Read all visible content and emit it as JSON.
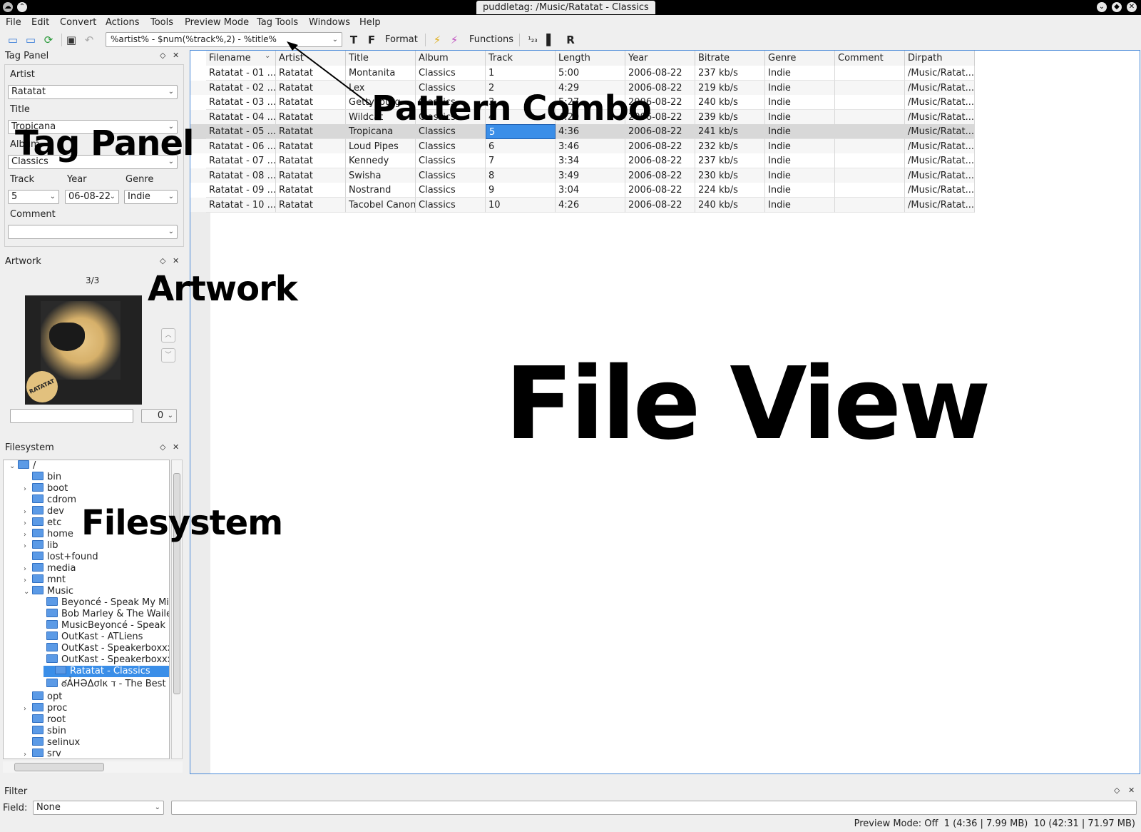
{
  "window": {
    "title": "puddletag: /Music/Ratatat - Classics"
  },
  "menu": [
    "File",
    "Edit",
    "Convert",
    "Actions",
    "Tools",
    "Preview Mode",
    "Tag Tools",
    "Windows",
    "Help"
  ],
  "toolbar": {
    "pattern": "%artist% - $num(%track%,2) - %title%",
    "format_label": "Format",
    "functions_label": "Functions"
  },
  "tag_panel": {
    "title": "Tag Panel",
    "artist_label": "Artist",
    "artist_value": "Ratatat",
    "title_label": "Title",
    "title_value": "Tropicana",
    "album_label": "Album",
    "album_value": "Classics",
    "track_label": "Track",
    "track_value": "5",
    "year_label": "Year",
    "year_value": "06-08-22",
    "genre_label": "Genre",
    "genre_value": "Indie",
    "comment_label": "Comment",
    "comment_value": ""
  },
  "artwork": {
    "title": "Artwork",
    "counter": "3/3",
    "cover_text": "RATATAT",
    "description_value": "",
    "type_value": "0"
  },
  "filesystem": {
    "title": "Filesystem",
    "items": [
      {
        "label": "/",
        "expanded": true
      },
      {
        "label": "bin"
      },
      {
        "label": "boot",
        "expandable": true
      },
      {
        "label": "cdrom"
      },
      {
        "label": "dev",
        "expandable": true
      },
      {
        "label": "etc",
        "expandable": true
      },
      {
        "label": "home",
        "expandable": true
      },
      {
        "label": "lib",
        "expandable": true
      },
      {
        "label": "lost+found"
      },
      {
        "label": "media",
        "expandable": true
      },
      {
        "label": "mnt",
        "expandable": true
      },
      {
        "label": "Music",
        "expanded": true
      },
      {
        "label": "Beyoncé - Speak My Min"
      },
      {
        "label": "Bob Marley & The Wailer"
      },
      {
        "label": "MusicBeyoncé - Speak M"
      },
      {
        "label": "OutKast - ATLiens"
      },
      {
        "label": "OutKast - Speakerboxxx"
      },
      {
        "label": "OutKast - Speakerboxxx"
      },
      {
        "label": "Ratatat - Classics",
        "selected": true
      },
      {
        "label": "ఠẢHƏΔσΙκ ד - The Best c"
      },
      {
        "label": "opt"
      },
      {
        "label": "proc",
        "expandable": true
      },
      {
        "label": "root"
      },
      {
        "label": "sbin"
      },
      {
        "label": "selinux"
      },
      {
        "label": "srv",
        "expandable": true
      }
    ]
  },
  "file_view": {
    "columns": [
      "Filename",
      "Artist",
      "Title",
      "Album",
      "Track",
      "Length",
      "Year",
      "Bitrate",
      "Genre",
      "Comment",
      "Dirpath"
    ],
    "rows": [
      [
        "Ratatat - 01 ...",
        "Ratatat",
        "Montanita",
        "Classics",
        "1",
        "5:00",
        "2006-08-22",
        "237 kb/s",
        "Indie",
        "",
        "/Music/Ratat..."
      ],
      [
        "Ratatat - 02 ...",
        "Ratatat",
        "Lex",
        "Classics",
        "2",
        "4:29",
        "2006-08-22",
        "219 kb/s",
        "Indie",
        "",
        "/Music/Ratat..."
      ],
      [
        "Ratatat - 03 ...",
        "Ratatat",
        "Gettysburg",
        "Classics",
        "3",
        "5:27",
        "2006-08-22",
        "240 kb/s",
        "Indie",
        "",
        "/Music/Ratat..."
      ],
      [
        "Ratatat - 04 ...",
        "Ratatat",
        "Wildcat",
        "Classics",
        "4",
        "4:20",
        "2006-08-22",
        "239 kb/s",
        "Indie",
        "",
        "/Music/Ratat..."
      ],
      [
        "Ratatat - 05 ...",
        "Ratatat",
        "Tropicana",
        "Classics",
        "5",
        "4:36",
        "2006-08-22",
        "241 kb/s",
        "Indie",
        "",
        "/Music/Ratat..."
      ],
      [
        "Ratatat - 06 ...",
        "Ratatat",
        "Loud Pipes",
        "Classics",
        "6",
        "3:46",
        "2006-08-22",
        "232 kb/s",
        "Indie",
        "",
        "/Music/Ratat..."
      ],
      [
        "Ratatat - 07 ...",
        "Ratatat",
        "Kennedy",
        "Classics",
        "7",
        "3:34",
        "2006-08-22",
        "237 kb/s",
        "Indie",
        "",
        "/Music/Ratat..."
      ],
      [
        "Ratatat - 08 ...",
        "Ratatat",
        "Swisha",
        "Classics",
        "8",
        "3:49",
        "2006-08-22",
        "230 kb/s",
        "Indie",
        "",
        "/Music/Ratat..."
      ],
      [
        "Ratatat - 09 ...",
        "Ratatat",
        "Nostrand",
        "Classics",
        "9",
        "3:04",
        "2006-08-22",
        "224 kb/s",
        "Indie",
        "",
        "/Music/Ratat..."
      ],
      [
        "Ratatat - 10 ...",
        "Ratatat",
        "Tacobel Canon",
        "Classics",
        "10",
        "4:26",
        "2006-08-22",
        "240 kb/s",
        "Indie",
        "",
        "/Music/Ratat..."
      ]
    ],
    "selected_row": 5
  },
  "annotations": {
    "pattern_combo": "Pattern Combo",
    "tag_panel": "Tag Panel",
    "artwork": "Artwork",
    "filesystem": "Filesystem",
    "file_view": "File View"
  },
  "filter": {
    "title": "Filter",
    "field_label": "Field:",
    "field_value": "None",
    "text_value": ""
  },
  "status": "Preview Mode: Off  1 (4:36 | 7.99 MB)  10 (42:31 | 71.97 MB)",
  "colors": {
    "selection": "#3a8ee8",
    "folder": "#5b9ae6",
    "focus_border": "#4a8ad8"
  }
}
